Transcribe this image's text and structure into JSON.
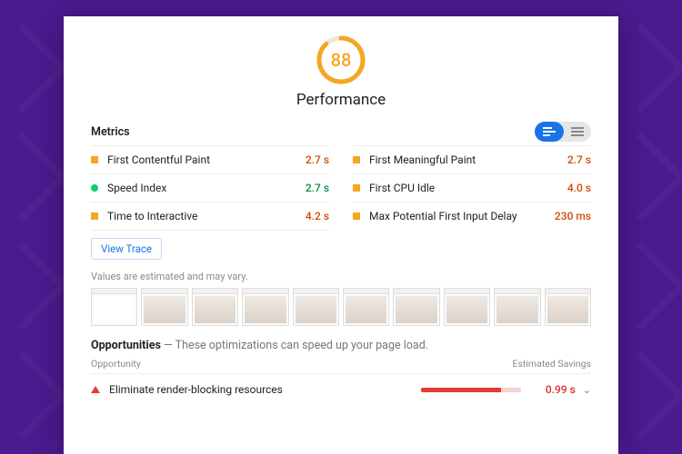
{
  "score": {
    "value": "88",
    "title": "Performance"
  },
  "metrics_heading": "Metrics",
  "metrics": {
    "left": [
      {
        "dot": "orange",
        "name": "First Contentful Paint",
        "value": "2.7 s",
        "cls": "orange"
      },
      {
        "dot": "green",
        "name": "Speed Index",
        "value": "2.7 s",
        "cls": "green"
      },
      {
        "dot": "orange",
        "name": "Time to Interactive",
        "value": "4.2 s",
        "cls": "orange"
      }
    ],
    "right": [
      {
        "dot": "orange",
        "name": "First Meaningful Paint",
        "value": "2.7 s",
        "cls": "orange"
      },
      {
        "dot": "orange",
        "name": "First CPU Idle",
        "value": "4.0 s",
        "cls": "orange"
      },
      {
        "dot": "orange",
        "name": "Max Potential First Input Delay",
        "value": "230 ms",
        "cls": "orange"
      }
    ]
  },
  "view_trace_label": "View Trace",
  "disclaimer": "Values are estimated and may vary.",
  "opportunities": {
    "heading": "Opportunities",
    "subheading": "These optimizations can speed up your page load.",
    "col_left": "Opportunity",
    "col_right": "Estimated Savings",
    "items": [
      {
        "name": "Eliminate render-blocking resources",
        "value": "0.99 s"
      }
    ]
  }
}
